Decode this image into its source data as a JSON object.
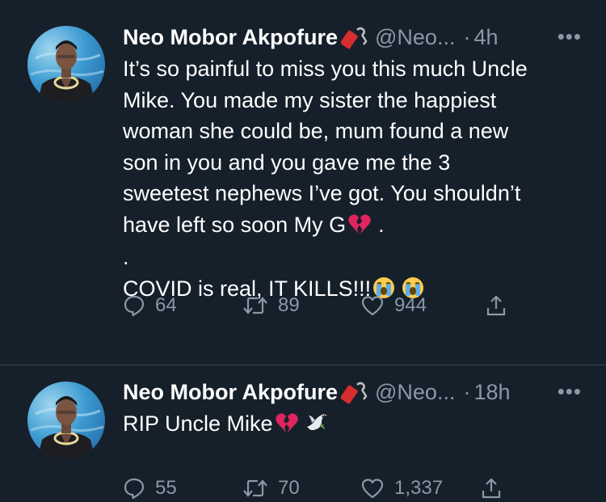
{
  "tweets": [
    {
      "author_name": "Neo Mobor Akpofure",
      "handle": "@Neo...",
      "separator": "·",
      "time": "4h",
      "more": "•••",
      "lines": [
        "It’s so painful to miss you this much Uncle",
        "Mike. You made my sister the happiest",
        "woman she could be, mum found a new",
        "son in you and you gave me the 3",
        "sweetest nephews I’ve got. You shouldn’t",
        "have left so soon My G",
        ".",
        "COVID is real, IT KILLS!!!"
      ],
      "line_6_suffix": ".",
      "replies": "64",
      "retweets": "89",
      "likes": "944"
    },
    {
      "author_name": "Neo Mobor Akpofure",
      "handle": "@Neo...",
      "separator": "·",
      "time": "18h",
      "more": "•••",
      "text": "RIP Uncle Mike",
      "replies": "55",
      "retweets": "70",
      "likes": "1,337"
    }
  ],
  "icons": {
    "badge": "firecracker-icon",
    "reply": "reply-icon",
    "retweet": "retweet-icon",
    "like": "heart-icon",
    "share": "share-icon",
    "emoji_broken_heart": "broken-heart-icon",
    "emoji_crying": "loudly-crying-face-icon",
    "emoji_dove": "dove-icon"
  },
  "colors": {
    "background": "#15202b",
    "secondary_text": "#8b98a5",
    "divider": "#38444d",
    "broken_heart": "#e0245e"
  }
}
